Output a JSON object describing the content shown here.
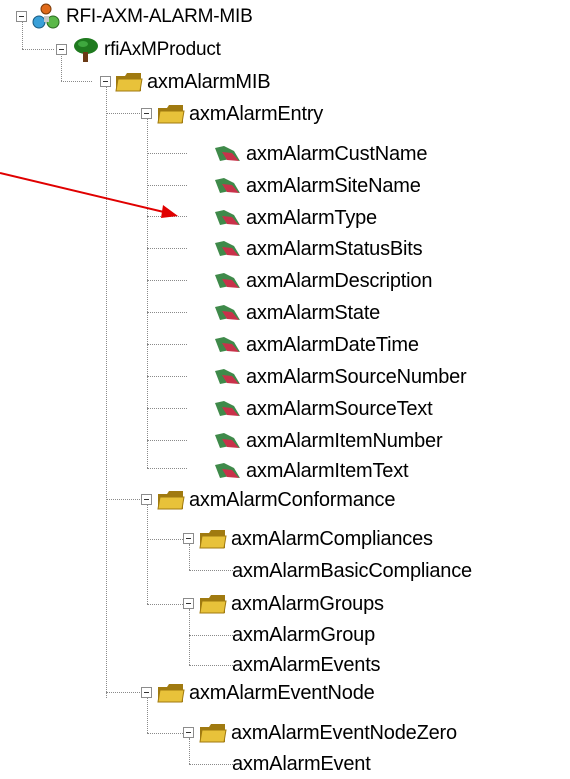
{
  "tree": {
    "root": {
      "label": "RFI-AXM-ALARM-MIB",
      "icon": "network-globe-icon"
    },
    "product": {
      "label": "rfiAxMProduct",
      "icon": "tree-icon"
    },
    "alarm_mib": {
      "label": "axmAlarmMIB",
      "icon": "folder-icon"
    },
    "alarm_entry": {
      "label": "axmAlarmEntry",
      "icon": "folder-icon",
      "leaves": [
        "axmAlarmCustName",
        "axmAlarmSiteName",
        "axmAlarmType",
        "axmAlarmStatusBits",
        "axmAlarmDescription",
        "axmAlarmState",
        "axmAlarmDateTime",
        "axmAlarmSourceNumber",
        "axmAlarmSourceText",
        "axmAlarmItemNumber",
        "axmAlarmItemText"
      ],
      "leaf_icon": "mib-leaf-icon"
    },
    "conformance": {
      "label": "axmAlarmConformance",
      "icon": "folder-icon"
    },
    "compliances": {
      "label": "axmAlarmCompliances",
      "icon": "folder-icon"
    },
    "basic_compliance": {
      "label": "axmAlarmBasicCompliance"
    },
    "groups": {
      "label": "axmAlarmGroups",
      "icon": "folder-icon"
    },
    "group": {
      "label": "axmAlarmGroup"
    },
    "events": {
      "label": "axmAlarmEvents"
    },
    "event_node": {
      "label": "axmAlarmEventNode",
      "icon": "folder-icon"
    },
    "event_node_zero": {
      "label": "axmAlarmEventNodeZero",
      "icon": "folder-icon"
    },
    "event": {
      "label": "axmAlarmEvent"
    }
  },
  "colors": {
    "arrow": "#e00000",
    "folder": "#e8c23a",
    "folder_dark": "#a07a10",
    "tree_lines": "#8a8a8a"
  }
}
